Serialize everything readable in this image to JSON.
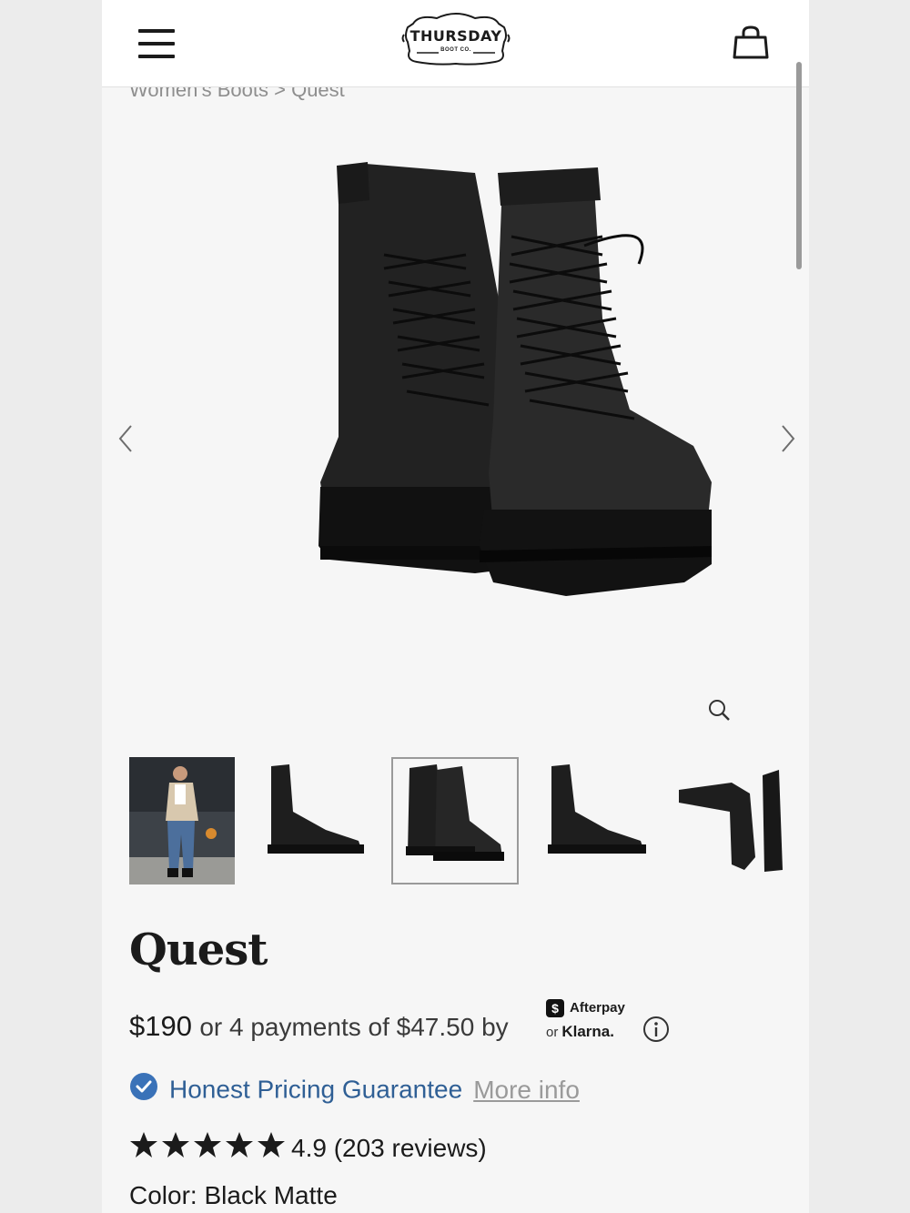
{
  "header": {
    "logo_main": "THURSDAY",
    "logo_sub": "BOOT CO."
  },
  "breadcrumb": {
    "category": "Women's Boots",
    "separator": ">",
    "current": "Quest"
  },
  "gallery": {
    "thumbnails": [
      "lifestyle-photo",
      "side-view",
      "pair-view",
      "side-view-alt",
      "sole-view"
    ],
    "selected_index": 2
  },
  "product": {
    "title": "Quest",
    "price": "$190",
    "installments_text": "or 4 payments of $47.50 by",
    "afterpay_label": "Afterpay",
    "afterpay_badge": "$",
    "klarna_or": "or",
    "klarna_label": "Klarna.",
    "guarantee_label": "Honest Pricing Guarantee",
    "more_info_label": "More info",
    "rating_value": 4.9,
    "rating_text": "4.9 (203 reviews)",
    "color_label": "Color:",
    "color_value": "Black Matte"
  },
  "colors": {
    "accent_blue": "#2f5f95",
    "check_blue": "#3a72b8"
  }
}
